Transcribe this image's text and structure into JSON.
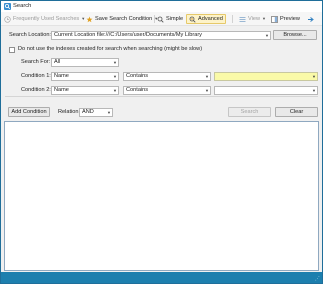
{
  "window": {
    "title": "Search"
  },
  "toolbar": {
    "recent_label": "Frequently Used Searches",
    "save_label": "Save Search Condition",
    "simple_label": "Simple",
    "advanced_label": "Advanced",
    "view_label": "View",
    "preview_label": "Preview"
  },
  "form": {
    "location_label": "Search Location:",
    "location_value": "Current Location file:///C:/Users/user/Documents/My Library",
    "browse_label": "Browse...",
    "indexes_label": "Do not use the indexes created for search when searching (might be slow)",
    "search_for_label": "Search For:",
    "search_for_value": "All",
    "condition1_label": "Condition 1:",
    "condition1_field": "Name",
    "condition1_operator": "Contains",
    "condition1_value": "",
    "condition2_label": "Condition 2:",
    "condition2_field": "Name",
    "condition2_operator": "Contains",
    "condition2_value": "",
    "add_condition_label": "Add Condition",
    "relation_label": "Relation:",
    "relation_value": "AND",
    "search_button_label": "Search",
    "clear_button_label": "Clear"
  },
  "colors": {
    "accent": "#1d7fae",
    "active_tab_bg": "#fdf3c9",
    "highlight_field": "#fafaa8"
  }
}
